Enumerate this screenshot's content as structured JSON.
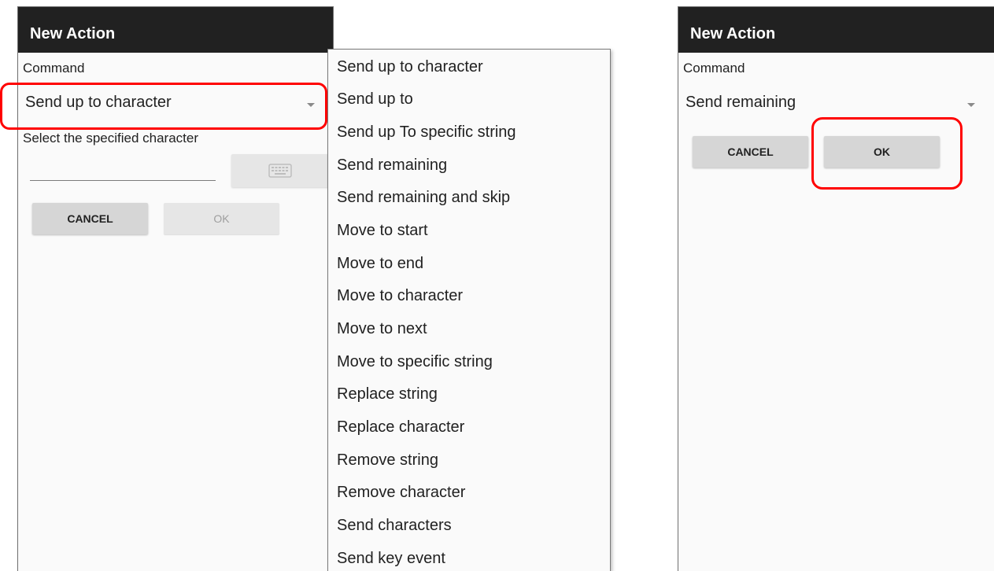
{
  "left_dialog": {
    "title": "New Action",
    "command_label": "Command",
    "spinner_value": "Send up to character",
    "hint_label": "Select the specified character",
    "input_value": "",
    "cancel_label": "CANCEL",
    "ok_label": "OK",
    "ok_enabled": false
  },
  "dropdown": {
    "items": [
      "Send up to character",
      "Send up to",
      "Send up To specific string",
      "Send remaining",
      "Send remaining and skip",
      "Move to start",
      "Move to end",
      "Move to character",
      "Move to next",
      "Move to specific string",
      "Replace string",
      "Replace character",
      "Remove string",
      "Remove character",
      "Send characters",
      "Send key event"
    ]
  },
  "right_dialog": {
    "title": "New Action",
    "command_label": "Command",
    "spinner_value": "Send remaining",
    "cancel_label": "CANCEL",
    "ok_label": "OK",
    "ok_enabled": true
  },
  "colors": {
    "titlebar": "#212121",
    "highlight": "#ff0000",
    "button": "#d6d6d6",
    "button_disabled": "#e6e6e6"
  },
  "icons": [
    "dropdown-caret-icon",
    "keyboard-icon"
  ]
}
